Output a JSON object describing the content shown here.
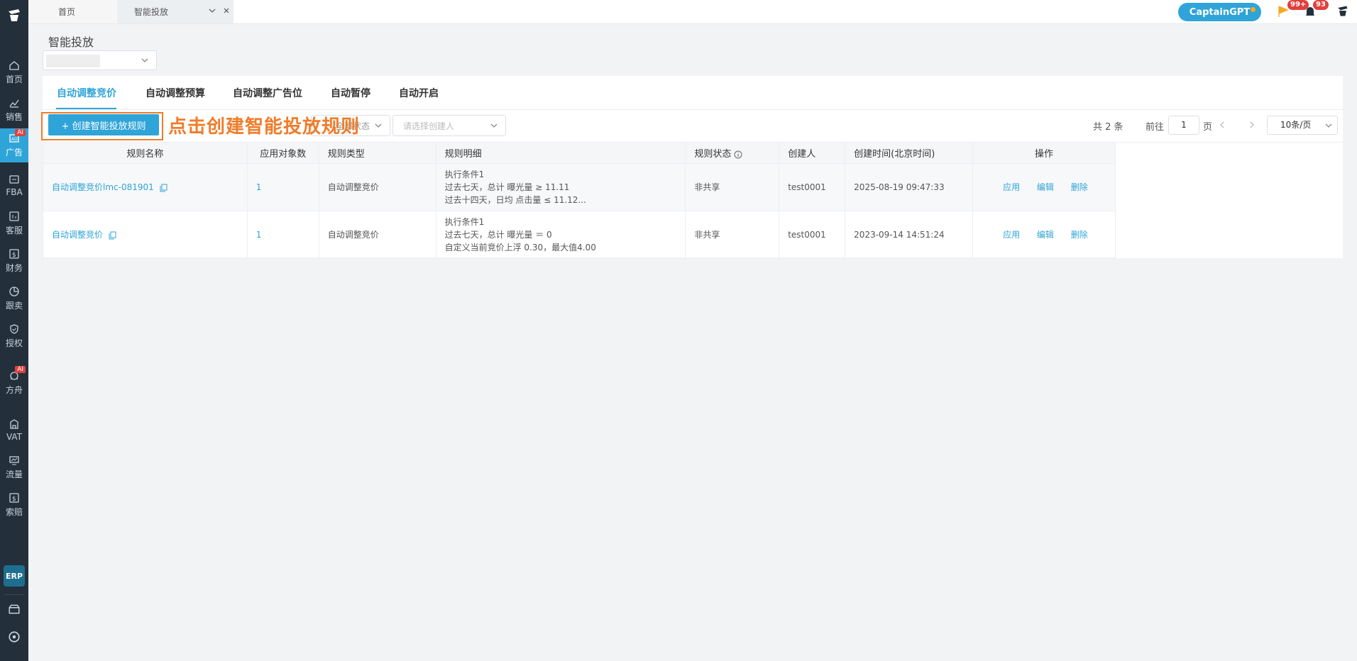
{
  "sidebar": {
    "items": [
      {
        "label": "首页",
        "icon": "home-icon"
      },
      {
        "label": "销售",
        "icon": "chart-line-icon"
      },
      {
        "label": "广告",
        "icon": "ad-icon",
        "ai": "AI"
      },
      {
        "label": "FBA",
        "icon": "fba-icon"
      },
      {
        "label": "客服",
        "icon": "service-icon"
      },
      {
        "label": "财务",
        "icon": "dollar-icon"
      },
      {
        "label": "跟卖",
        "icon": "pie-icon"
      },
      {
        "label": "授权",
        "icon": "shield-icon"
      },
      {
        "label": "方舟",
        "icon": "ark-icon",
        "ai": "AI"
      },
      {
        "label": "VAT",
        "icon": "building-icon"
      },
      {
        "label": "流量",
        "icon": "monitor-icon"
      },
      {
        "label": "索赔",
        "icon": "claim-icon"
      }
    ],
    "erp": "ERP"
  },
  "tabs": {
    "home": "首页",
    "smart": "智能投放"
  },
  "topbar": {
    "gpt": "CaptainGPT",
    "flag_badge": "99+",
    "bell_badge": "93"
  },
  "page": {
    "title": "智能投放"
  },
  "subtabs": [
    "自动调整竞价",
    "自动调整预算",
    "自动调整广告位",
    "自动暂停",
    "自动开启"
  ],
  "toolbar": {
    "create_btn": "+ 创建智能投放规则",
    "annotation": "点击创建智能投放规则",
    "status_select": "全部状态",
    "creator_placeholder": "请选择创建人"
  },
  "pagination": {
    "total": "共 2 条",
    "goto": "前往",
    "page": "1",
    "page_unit": "页",
    "size": "10条/页"
  },
  "table": {
    "headers": [
      "规则名称",
      "应用对象数",
      "规则类型",
      "规则明细",
      "规则状态",
      "创建人",
      "创建时间(北京时间)",
      "操作"
    ],
    "rows": [
      {
        "name": "自动调整竞价lmc-081901",
        "count": "1",
        "type": "自动调整竞价",
        "detail1": "执行条件1",
        "detail2": "过去七天，总计  曝光量 ≥ 11.11",
        "detail3": "过去十四天，日均  点击量 ≤ 11.12...",
        "status": "非共享",
        "creator": "test0001",
        "time": "2025-08-19 09:47:33"
      },
      {
        "name": "自动调整竞价",
        "count": "1",
        "type": "自动调整竞价",
        "detail1": "执行条件1",
        "detail2": "过去七天，总计  曝光量 ＝ 0",
        "detail3": "自定义当前竞价上浮 0.30，最大值4.00",
        "status": "非共享",
        "creator": "test0001",
        "time": "2023-09-14 14:51:24"
      }
    ],
    "actions": {
      "apply": "应用",
      "edit": "编辑",
      "delete": "删除"
    }
  },
  "colors": {
    "accent": "#2fa4d8",
    "sidebar": "#23303c",
    "annotation": "#f07c2a",
    "badge": "#e0403d"
  }
}
